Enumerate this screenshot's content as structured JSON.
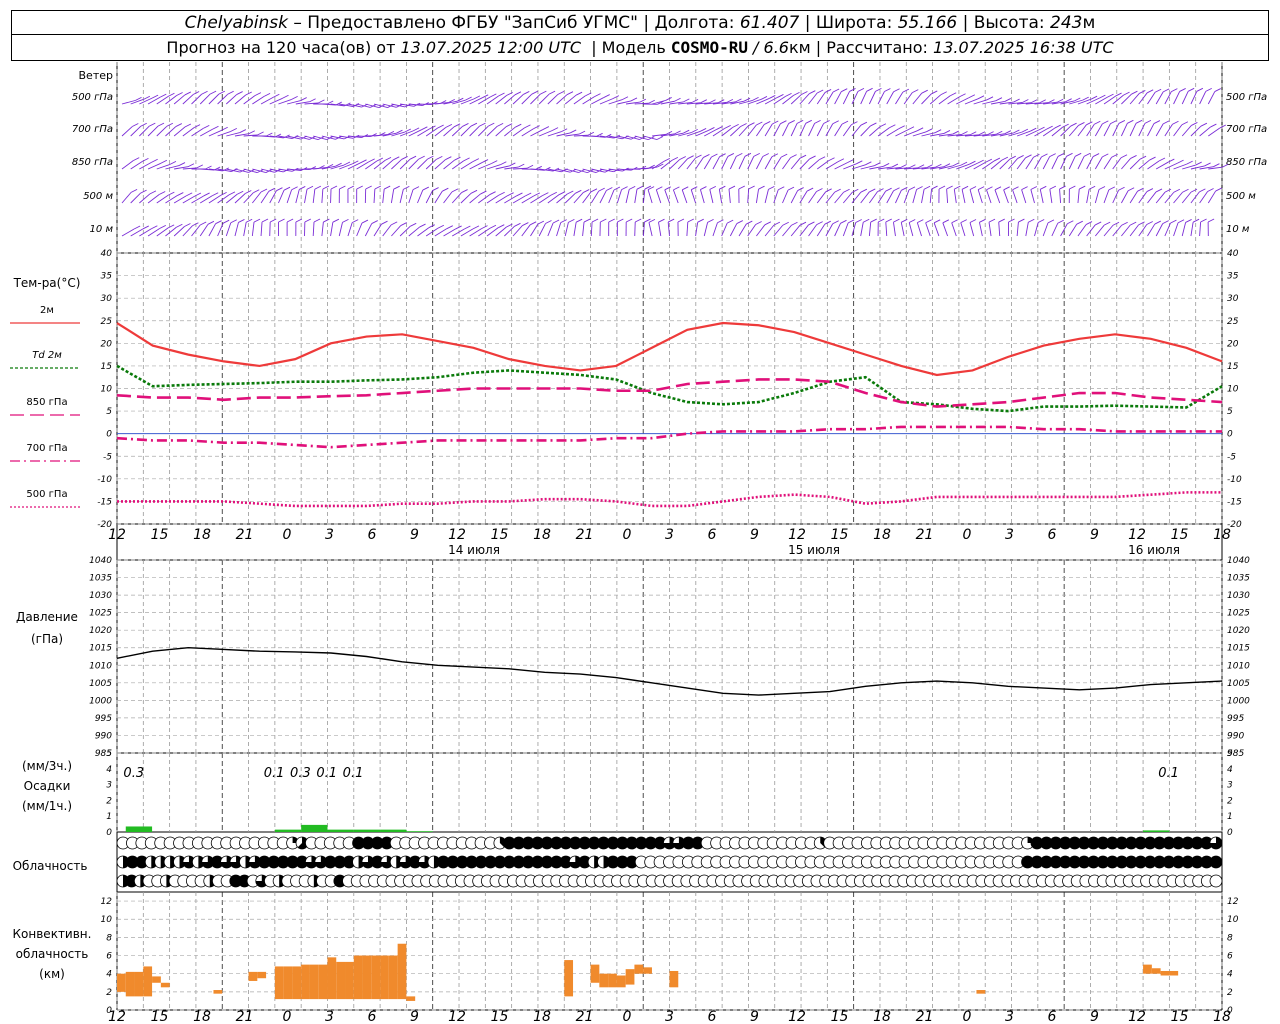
{
  "header": {
    "line1": {
      "city": "Chelyabinsk",
      "source": " – Предоставлено ФГБУ \"ЗапСиб УГМС\" | Долгота: ",
      "lon": "61.407",
      "lat_label": " | Широта: ",
      "lat": "55.166",
      "alt_label": " | Высота: ",
      "alt": "243",
      "alt_unit": "м"
    },
    "line2": {
      "forecast_label": "Прогноз на 120 часа(ов) от ",
      "forecast_time": "13.07.2025 12:00 UTC",
      "model_label": "  | Модель ",
      "model": "COSMO-RU",
      "res": " / 6.6",
      "res_unit": "км",
      "calc_label": " | Рассчитано: ",
      "calc_time": "13.07.2025 16:38 UTC"
    }
  },
  "labels": {
    "wind_title": "Ветер",
    "wind_levels": [
      "500 гПа",
      "700 гПа",
      "850 гПа",
      "500 м",
      "10 м"
    ],
    "temp_title": "Тем-ра(°C)",
    "legend": [
      {
        "text": "2м",
        "color": "#ee3a3a",
        "dash": ""
      },
      {
        "text": "Td 2м",
        "color": "#0a7a0a",
        "dash": "3,2"
      },
      {
        "text": "850 гПа",
        "color": "#e0107a",
        "dash": "14,6"
      },
      {
        "text": "700 гПа",
        "color": "#e0107a",
        "dash": "10,4,2,4"
      },
      {
        "text": "500 гПа",
        "color": "#e0107a",
        "dash": "2,2"
      }
    ],
    "pressure_title": "Давление",
    "pressure_unit": "(гПа)",
    "precip_unit1": "(мм/3ч.)",
    "precip_title": "Осадки",
    "precip_unit2": "(мм/1ч.)",
    "cloud_title": "Облачность",
    "conv_title1": "Конвективн.",
    "conv_title2": "облачность",
    "conv_unit": "(км)"
  },
  "chart_data": {
    "type": "line",
    "time_axis": {
      "start_hour": 12,
      "step_hours": 3,
      "total_hours": 126,
      "tick_labels": [
        "12",
        "15",
        "18",
        "21",
        "0",
        "3",
        "6",
        "9",
        "12",
        "15",
        "18",
        "21",
        "0",
        "3",
        "6",
        "9",
        "12",
        "15",
        "18",
        "21",
        "0",
        "3",
        "6",
        "9",
        "12",
        "15",
        "18"
      ],
      "day_labels": [
        "14 июля",
        "15 июля",
        "16 июля"
      ],
      "midnights_at_hours": [
        12,
        36,
        60
      ]
    },
    "temperature": {
      "ylim": [
        -20,
        40
      ],
      "ticks": [
        -20,
        -15,
        -10,
        -5,
        0,
        5,
        10,
        15,
        20,
        25,
        30,
        35,
        40
      ],
      "series": [
        {
          "name": "2м",
          "color": "#ee3a3a",
          "dash": "",
          "values": [
            24.5,
            19.5,
            17.5,
            16,
            15,
            16.5,
            20,
            21.5,
            22,
            20.5,
            19,
            16.5,
            15,
            14,
            15,
            19,
            23,
            24.5,
            24,
            22.5,
            20,
            17.5,
            15,
            13,
            14,
            17,
            19.5,
            21,
            22,
            21,
            19,
            16
          ]
        },
        {
          "name": "Td 2м",
          "color": "#0a7a0a",
          "dash": "3,2",
          "values": [
            15,
            10.5,
            10.8,
            11,
            11.2,
            11.5,
            11.5,
            11.8,
            12,
            12.5,
            13.5,
            14,
            13.5,
            13,
            12,
            9,
            7,
            6.5,
            7,
            9,
            11.5,
            12.5,
            7,
            6.5,
            5.5,
            5,
            6,
            6,
            6.2,
            6,
            5.8,
            10.5
          ]
        },
        {
          "name": "850 гПа",
          "color": "#e0107a",
          "dash": "14,6",
          "values": [
            8.5,
            8,
            8,
            7.5,
            8,
            8,
            8.3,
            8.5,
            9,
            9.5,
            10,
            10,
            10,
            10,
            9.5,
            9.5,
            11,
            11.5,
            12,
            12,
            11.5,
            9,
            7,
            6,
            6.5,
            7,
            8,
            9,
            9,
            8,
            7.5,
            7
          ]
        },
        {
          "name": "700 гПа",
          "color": "#e0107a",
          "dash": "10,4,2,4",
          "values": [
            -1,
            -1.5,
            -1.5,
            -2,
            -2,
            -2.5,
            -3,
            -2.5,
            -2,
            -1.5,
            -1.5,
            -1.5,
            -1.5,
            -1.5,
            -1,
            -1,
            0,
            0.5,
            0.5,
            0.5,
            1,
            1,
            1.5,
            1.5,
            1.5,
            1.5,
            1,
            1,
            0.5,
            0.5,
            0.5,
            0.5
          ]
        },
        {
          "name": "500 гПа",
          "color": "#e0107a",
          "dash": "2,2",
          "values": [
            -15,
            -15,
            -15,
            -15,
            -15.5,
            -16,
            -16,
            -16,
            -15.5,
            -15.5,
            -15,
            -15,
            -14.5,
            -14.5,
            -15,
            -16,
            -16,
            -15,
            -14,
            -13.5,
            -14,
            -15.5,
            -15,
            -14,
            -14,
            -14,
            -14,
            -14,
            -14,
            -13.5,
            -13,
            -13
          ]
        }
      ]
    },
    "pressure": {
      "ylim": [
        985,
        1040
      ],
      "ticks": [
        985,
        990,
        995,
        1000,
        1005,
        1010,
        1015,
        1020,
        1025,
        1030,
        1035,
        1040
      ],
      "color": "#000000",
      "values": [
        1012,
        1014,
        1015,
        1014.5,
        1014,
        1013.8,
        1013.5,
        1012.5,
        1011,
        1010,
        1009.5,
        1009,
        1008,
        1007.5,
        1006.5,
        1005,
        1003.5,
        1002,
        1001.5,
        1002,
        1002.5,
        1004,
        1005,
        1005.5,
        1005,
        1004,
        1003.5,
        1003,
        1003.5,
        1004.5,
        1005,
        1005.5
      ]
    },
    "precipitation": {
      "ylim": [
        0,
        5
      ],
      "ticks_left": [
        0,
        1,
        2,
        3,
        4,
        5
      ],
      "ticks_right": [
        0,
        1,
        2,
        3,
        4,
        5
      ],
      "color": "#22bb22",
      "bars": [
        {
          "hour": 1,
          "width_hours": 3,
          "value": 0.35
        },
        {
          "hour": 18,
          "width_hours": 3,
          "value": 0.15
        },
        {
          "hour": 21,
          "width_hours": 3,
          "value": 0.45
        },
        {
          "hour": 24,
          "width_hours": 3,
          "value": 0.15
        },
        {
          "hour": 27,
          "width_hours": 3,
          "value": 0.15
        },
        {
          "hour": 30,
          "width_hours": 3,
          "value": 0.15
        },
        {
          "hour": 33,
          "width_hours": 3,
          "value": 0.05
        },
        {
          "hour": 117,
          "width_hours": 3,
          "value": 0.1
        }
      ],
      "labels": [
        {
          "hour": 1,
          "text": "0.3"
        },
        {
          "hour": 17,
          "text": "0.1"
        },
        {
          "hour": 20,
          "text": "0.3"
        },
        {
          "hour": 23,
          "text": "0.1"
        },
        {
          "hour": 26,
          "text": "0.1"
        },
        {
          "hour": 119,
          "text": "0.1"
        }
      ]
    },
    "cloudiness": {
      "rows": 3,
      "row_legend": "",
      "octas_top": [
        0,
        0,
        0,
        0,
        0,
        0,
        0,
        0,
        0,
        0,
        0,
        0,
        0,
        0,
        0,
        0,
        0,
        0,
        2,
        5,
        0,
        0,
        0,
        0,
        0,
        8,
        8,
        8,
        8,
        0,
        0,
        0,
        0,
        0,
        0,
        0,
        0,
        0,
        0,
        0,
        3,
        8,
        8,
        8,
        8,
        8,
        8,
        8,
        8,
        8,
        8,
        8,
        8,
        8,
        8,
        8,
        8,
        8,
        6,
        6,
        8,
        8,
        0,
        0,
        0,
        0,
        0,
        0,
        0,
        0,
        0,
        0,
        0,
        0,
        3,
        0,
        0,
        0,
        0,
        0,
        0,
        0,
        0,
        0,
        0,
        0,
        0,
        0,
        0,
        0,
        0,
        0,
        0,
        0,
        0,
        0,
        2,
        8,
        8,
        8,
        8,
        8,
        8,
        8,
        8,
        8,
        8,
        8,
        8,
        8,
        8,
        8,
        8,
        8,
        8,
        8,
        6
      ],
      "octas_mid": [
        4,
        8,
        8,
        4,
        4,
        4,
        4,
        6,
        4,
        6,
        8,
        6,
        6,
        4,
        6,
        8,
        8,
        8,
        8,
        8,
        6,
        6,
        8,
        8,
        8,
        4,
        6,
        8,
        6,
        4,
        6,
        8,
        6,
        4,
        8,
        8,
        8,
        8,
        8,
        8,
        8,
        8,
        8,
        8,
        8,
        8,
        8,
        8,
        6,
        8,
        4,
        4,
        8,
        8,
        8,
        0,
        0,
        0,
        0,
        0,
        0,
        0,
        0,
        0,
        0,
        0,
        0,
        0,
        0,
        0,
        0,
        0,
        0,
        0,
        0,
        0,
        0,
        0,
        0,
        0,
        0,
        0,
        0,
        0,
        0,
        0,
        0,
        0,
        0,
        0,
        0,
        0,
        0,
        0,
        0,
        0,
        8,
        8,
        8,
        8,
        8,
        8,
        8,
        8,
        8,
        8,
        8,
        8,
        8,
        8,
        8,
        8,
        8,
        8,
        8,
        8,
        8
      ],
      "octas_low": [
        4,
        8,
        4,
        0,
        0,
        4,
        0,
        0,
        0,
        0,
        4,
        0,
        0,
        8,
        8,
        0,
        6,
        0,
        4,
        0,
        0,
        0,
        4,
        0,
        0,
        8,
        0,
        0,
        0,
        0,
        0,
        0,
        0,
        0,
        0,
        0,
        0,
        0,
        0,
        0,
        0,
        0,
        0,
        0,
        0,
        0,
        0,
        0,
        0,
        0,
        0,
        0,
        0,
        0,
        0,
        0,
        0,
        0,
        0,
        0,
        0,
        0,
        0,
        0,
        0,
        0,
        0,
        0,
        0,
        0,
        0,
        0,
        0,
        0,
        0,
        0,
        0,
        0,
        0,
        0,
        0,
        0,
        0,
        0,
        0,
        0,
        0,
        0,
        0,
        0,
        0,
        0,
        0,
        0,
        0,
        0,
        0,
        0,
        0,
        0,
        0,
        0,
        0,
        0,
        0,
        0,
        0,
        0,
        0,
        0,
        0,
        0,
        0,
        0,
        0,
        0,
        0,
        0,
        0,
        0,
        0,
        0,
        0,
        0,
        0,
        0,
        0
      ]
    },
    "convective": {
      "ylim": [
        0,
        13
      ],
      "ticks": [
        0,
        2,
        4,
        6,
        8,
        10,
        12
      ],
      "color": "#f08a2c",
      "bars": [
        {
          "hour": 0.5,
          "width_hours": 1,
          "base": 2,
          "top": 4
        },
        {
          "hour": 1.5,
          "width_hours": 1,
          "base": 1.5,
          "top": 4.2
        },
        {
          "hour": 2.5,
          "width_hours": 1,
          "base": 1.5,
          "top": 4.2
        },
        {
          "hour": 3.5,
          "width_hours": 1,
          "base": 1.5,
          "top": 4.8
        },
        {
          "hour": 4.5,
          "width_hours": 1,
          "base": 3,
          "top": 3.7
        },
        {
          "hour": 5.5,
          "width_hours": 1,
          "base": 2.5,
          "top": 3
        },
        {
          "hour": 11.5,
          "width_hours": 1,
          "base": 1.8,
          "top": 2.2
        },
        {
          "hour": 15.5,
          "width_hours": 1,
          "base": 3.2,
          "top": 4.2
        },
        {
          "hour": 16.5,
          "width_hours": 1,
          "base": 3.5,
          "top": 4.2
        },
        {
          "hour": 18.5,
          "width_hours": 1,
          "base": 1.2,
          "top": 4.8
        },
        {
          "hour": 19.5,
          "width_hours": 1,
          "base": 1.2,
          "top": 4.8
        },
        {
          "hour": 20.5,
          "width_hours": 1,
          "base": 1.2,
          "top": 4.8
        },
        {
          "hour": 21.5,
          "width_hours": 1,
          "base": 1.2,
          "top": 5
        },
        {
          "hour": 22.5,
          "width_hours": 1,
          "base": 1.2,
          "top": 5
        },
        {
          "hour": 23.5,
          "width_hours": 1,
          "base": 1.2,
          "top": 5
        },
        {
          "hour": 24.5,
          "width_hours": 1,
          "base": 1.2,
          "top": 5.8
        },
        {
          "hour": 25.5,
          "width_hours": 1,
          "base": 1.2,
          "top": 5.3
        },
        {
          "hour": 26.5,
          "width_hours": 1,
          "base": 1.2,
          "top": 5.3
        },
        {
          "hour": 27.5,
          "width_hours": 1,
          "base": 1.2,
          "top": 6
        },
        {
          "hour": 28.5,
          "width_hours": 1,
          "base": 1.2,
          "top": 6
        },
        {
          "hour": 29.5,
          "width_hours": 1,
          "base": 1.2,
          "top": 6
        },
        {
          "hour": 30.5,
          "width_hours": 1,
          "base": 1.2,
          "top": 6
        },
        {
          "hour": 31.5,
          "width_hours": 1,
          "base": 1.2,
          "top": 6
        },
        {
          "hour": 32.5,
          "width_hours": 1,
          "base": 1.2,
          "top": 7.3
        },
        {
          "hour": 33.5,
          "width_hours": 1,
          "base": 1,
          "top": 1.5
        },
        {
          "hour": 51.5,
          "width_hours": 1,
          "base": 1.5,
          "top": 5.5
        },
        {
          "hour": 54.5,
          "width_hours": 1,
          "base": 3,
          "top": 5
        },
        {
          "hour": 55.5,
          "width_hours": 1,
          "base": 2.5,
          "top": 4
        },
        {
          "hour": 56.5,
          "width_hours": 1,
          "base": 2.5,
          "top": 4
        },
        {
          "hour": 57.5,
          "width_hours": 1,
          "base": 2.5,
          "top": 3.8
        },
        {
          "hour": 58.5,
          "width_hours": 1,
          "base": 2.8,
          "top": 4.5
        },
        {
          "hour": 59.5,
          "width_hours": 1,
          "base": 4,
          "top": 5
        },
        {
          "hour": 60.5,
          "width_hours": 1,
          "base": 4,
          "top": 4.7
        },
        {
          "hour": 63.5,
          "width_hours": 1,
          "base": 2.5,
          "top": 4.3
        },
        {
          "hour": 98.5,
          "width_hours": 1,
          "base": 1.8,
          "top": 2.2
        },
        {
          "hour": 117.5,
          "width_hours": 1,
          "base": 4,
          "top": 5
        },
        {
          "hour": 118.5,
          "width_hours": 1,
          "base": 4,
          "top": 4.6
        },
        {
          "hour": 119.5,
          "width_hours": 1,
          "base": 3.8,
          "top": 4.3
        },
        {
          "hour": 120.5,
          "width_hours": 1,
          "base": 3.8,
          "top": 4.3
        }
      ]
    },
    "wind": {
      "color": "#7a2cd6",
      "columns": 126,
      "rows": 5
    }
  }
}
